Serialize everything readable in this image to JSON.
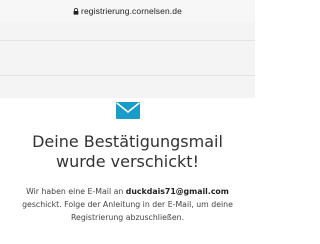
{
  "browser": {
    "url": "registrierung.cornelsen.de"
  },
  "confirmation": {
    "icon": "envelope-icon",
    "accent_color": "#1a9cc9",
    "headline_line1": "Deine Bestätigungsmail",
    "headline_line2": "wurde verschickt!",
    "body_prefix": "Wir haben eine E-Mail an ",
    "email": "duckdais71@gmail.com",
    "body_suffix_line2": "geschickt. Folge der Anleitung in der E-Mail, um deine",
    "body_line3": "Registrierung abzuschließen."
  }
}
